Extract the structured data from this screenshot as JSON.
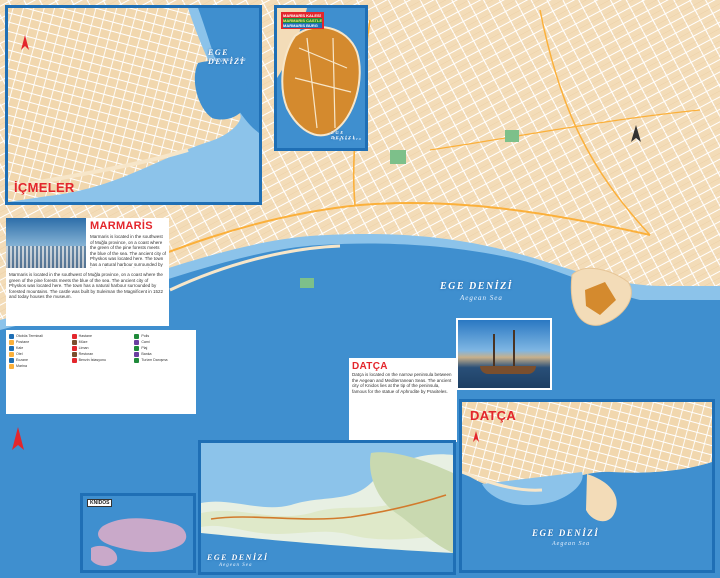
{
  "map": {
    "insets": {
      "icmeler": {
        "title": "İÇMELER",
        "sea": "EGE DENİZİ",
        "sea_sub": "Aegean Sea"
      },
      "castle": {
        "legend": [
          "MARMARİS KALESİ",
          "MARMARIS CASTLE",
          "MARMARIS BURG"
        ],
        "sea": "EGE DENİZİ",
        "sea_sub": "Aegean Sea"
      },
      "datca": {
        "title": "DATÇA",
        "sea": "EGE DENİZİ",
        "sea_sub": "Aegean Sea"
      },
      "knidos": {
        "title": "KNİDOS"
      },
      "peninsula": {
        "sea": "EGE DENİZİ",
        "sea_sub": "Aegean Sea"
      }
    },
    "main": {
      "sea": "EGE DENİZİ",
      "sea_sub": "Aegean Sea"
    },
    "info": {
      "marmaris_title": "MARMARİS",
      "datca_title": "DATÇA",
      "marmaris_text": "Marmaris is located in the southwest of Muğla province, on a coast where the green of the pine forests meets the blue of the sea. The ancient city of Physkos was located here. The town has a natural harbour surrounded by forested mountains. The castle was built by Suleiman the Magnificent in 1522 and today houses the museum.",
      "datca_text": "Datça is located on the narrow peninsula between the Aegean and Mediterranean Seas. The ancient city of Knidos lies at the tip of the peninsula, famous for the statue of Aphrodite by Praxiteles."
    },
    "legend_items": [
      "Otobüs Terminali",
      "Hastane",
      "Polis",
      "Postane",
      "Müze",
      "Cami",
      "Kale",
      "Liman",
      "Plaj",
      "Otel",
      "Restoran",
      "Banka",
      "Eczane",
      "Benzin İstasyonu",
      "Turizm Danışma",
      "Marina"
    ],
    "colors": {
      "sea": "#3f8fcf",
      "sea_light": "#8cc3ea",
      "land": "#f3dcb8",
      "land_dark": "#e9c99a",
      "frame": "#1f6fb5",
      "title_red": "#e3262c",
      "green": "#7dc08a",
      "castle_orange": "#d48a2e"
    }
  }
}
